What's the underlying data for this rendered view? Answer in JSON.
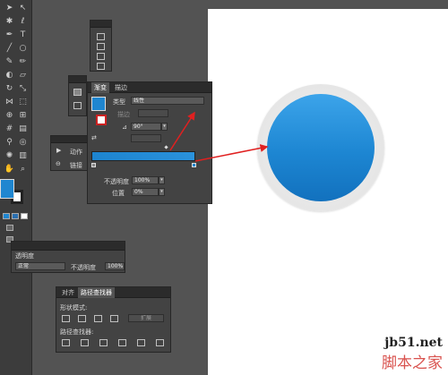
{
  "gradient_panel": {
    "tab_gradient": "渐变",
    "tab_stroke": "描边",
    "type_label": "类型",
    "type_value": "线性",
    "stroke_label": "描边",
    "angle_value": "90°",
    "opacity_label": "不透明度",
    "opacity_value": "100%",
    "position_label": "位置",
    "position_value": "0%",
    "gradient_start_color": "#1f86d0",
    "gradient_end_color": "#2c8fd8"
  },
  "actions_panel": {
    "action_label": "动作",
    "link_label": "链接"
  },
  "transparency_panel": {
    "title": "透明度",
    "mode_value": "正常",
    "opacity_label": "不透明度",
    "opacity_value": "100%"
  },
  "pathfinder_panel": {
    "tab_align": "对齐",
    "tab_pathfinder": "路径查找器",
    "shape_modes_label": "形状模式:",
    "expand_label": "扩展",
    "pathfinders_label": "路径查找器:"
  },
  "canvas": {
    "artwork_color": "#1f86d0"
  },
  "watermark": {
    "site": "jb51.net",
    "brand": "脚本之家"
  },
  "tool_icons": [
    "selection-tool-icon",
    "direct-selection-tool-icon",
    "magic-wand-icon",
    "lasso-icon",
    "pen-icon",
    "type-icon",
    "line-icon",
    "rectangle-icon",
    "paintbrush-icon",
    "pencil-icon",
    "blob-brush-icon",
    "eraser-icon",
    "rotate-icon",
    "scale-icon",
    "width-icon",
    "free-transform-icon",
    "shape-builder-icon",
    "perspective-icon",
    "mesh-icon",
    "gradient-icon",
    "eyedropper-icon",
    "blend-icon",
    "symbol-sprayer-icon",
    "graph-icon",
    "artboard-icon",
    "slice-icon",
    "hand-icon",
    "zoom-icon"
  ]
}
